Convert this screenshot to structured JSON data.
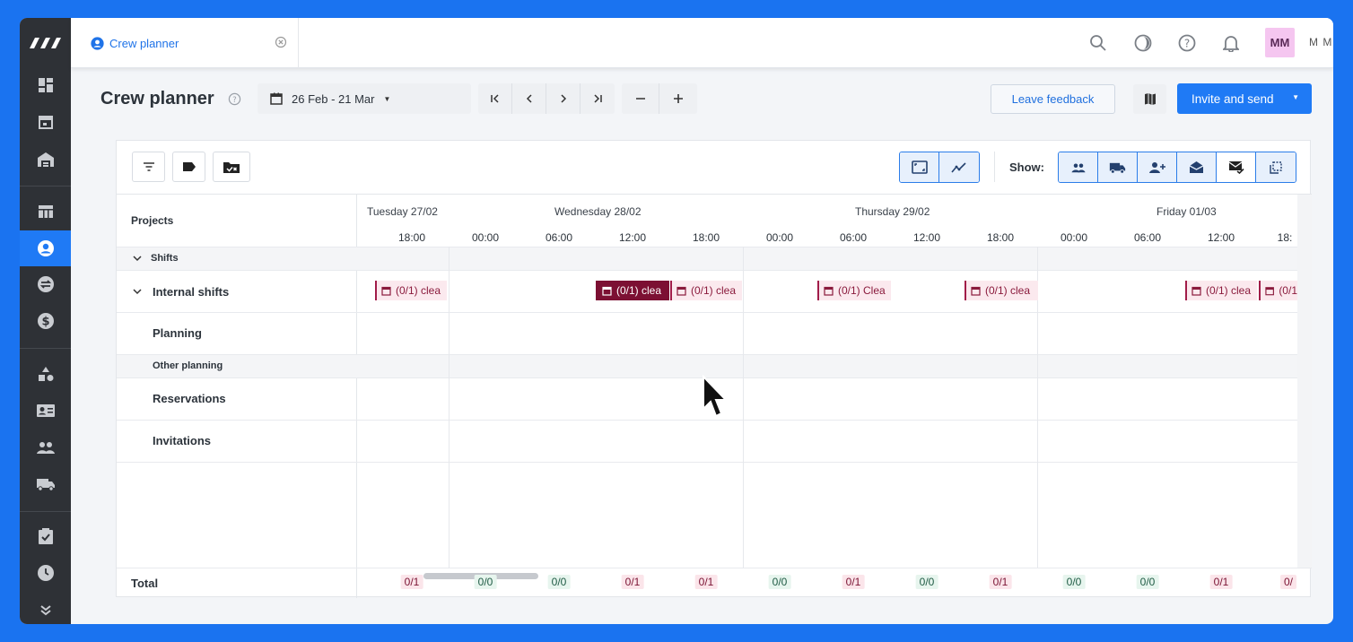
{
  "tab": {
    "label": "Crew planner"
  },
  "user": {
    "initials": "MM",
    "name": "M M"
  },
  "header": {
    "title": "Crew planner",
    "date_range": "26 Feb - 21 Mar",
    "leave_feedback": "Leave feedback",
    "invite_button": "Invite and send"
  },
  "toolbar": {
    "show_label": "Show:"
  },
  "grid": {
    "projects_header": "Projects",
    "rows": {
      "shifts": "Shifts",
      "internal_shifts": "Internal shifts",
      "planning": "Planning",
      "other_planning": "Other planning",
      "reservations": "Reservations",
      "invitations": "Invitations",
      "total": "Total"
    },
    "days": [
      "Tuesday 27/02",
      "Wednesday 28/02",
      "Thursday 29/02",
      "Friday 01/03"
    ],
    "hours": [
      "18:00",
      "00:00",
      "06:00",
      "12:00",
      "18:00",
      "00:00",
      "06:00",
      "12:00",
      "18:00",
      "00:00",
      "06:00",
      "12:00",
      "18:"
    ],
    "shifts": [
      {
        "label": "(0/1) clea",
        "selected": false
      },
      {
        "label": "(0/1) clea",
        "selected": true
      },
      {
        "label": "(0/1) clea",
        "selected": false
      },
      {
        "label": "(0/1) Clea",
        "selected": false
      },
      {
        "label": "(0/1) clea",
        "selected": false
      },
      {
        "label": "(0/1) clea",
        "selected": false
      },
      {
        "label": "(0/1",
        "selected": false
      }
    ],
    "totals": [
      {
        "value": "0/1",
        "status": "red"
      },
      {
        "value": "0/0",
        "status": "green"
      },
      {
        "value": "0/0",
        "status": "green"
      },
      {
        "value": "0/1",
        "status": "red"
      },
      {
        "value": "0/1",
        "status": "red"
      },
      {
        "value": "0/0",
        "status": "green"
      },
      {
        "value": "0/1",
        "status": "red"
      },
      {
        "value": "0/0",
        "status": "green"
      },
      {
        "value": "0/1",
        "status": "red"
      },
      {
        "value": "0/0",
        "status": "green"
      },
      {
        "value": "0/0",
        "status": "green"
      },
      {
        "value": "0/1",
        "status": "red"
      },
      {
        "value": "0/",
        "status": "red"
      }
    ]
  }
}
